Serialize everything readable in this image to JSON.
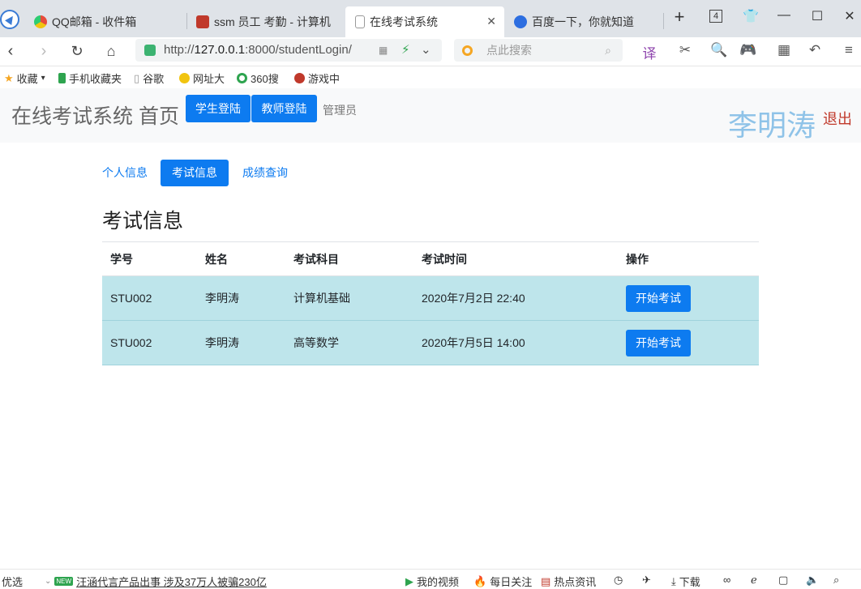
{
  "browser": {
    "tabs": [
      {
        "title": "QQ邮箱 - 收件箱",
        "active": false
      },
      {
        "title": "ssm 员工 考勤 - 计算机",
        "active": false
      },
      {
        "title": "在线考试系统",
        "active": true
      },
      {
        "title": "百度一下，你就知道",
        "active": false
      }
    ],
    "tab_count": "4",
    "url_prefix": "http://",
    "url_host": "127.0.0.1",
    "url_rest": ":8000/studentLogin/",
    "search_placeholder": "点此搜索",
    "bookmarks": [
      "收藏",
      "手机收藏夹",
      "谷歌",
      "网址大",
      "360搜",
      "游戏中"
    ]
  },
  "navbar": {
    "brand": "在线考试系统 首页",
    "student_login": "学生登陆",
    "teacher_login": "教师登陆",
    "admin": "管理员",
    "username": "李明涛",
    "logout": "退出"
  },
  "pills": {
    "profile": "个人信息",
    "exam_info": "考试信息",
    "scores": "成绩查询"
  },
  "main": {
    "heading": "考试信息",
    "columns": [
      "学号",
      "姓名",
      "考试科目",
      "考试时间",
      "操作"
    ],
    "rows": [
      {
        "id": "STU002",
        "name": "李明涛",
        "subject": "计算机基础",
        "time": "2020年7月2日 22:40",
        "action": "开始考试"
      },
      {
        "id": "STU002",
        "name": "李明涛",
        "subject": "高等数学",
        "time": "2020年7月5日 14:00",
        "action": "开始考试"
      }
    ]
  },
  "statusbar": {
    "left": "优选",
    "news_badge": "NEW",
    "news": "汪涵代言产品出事 涉及37万人被骗230亿",
    "video": "我的视频",
    "follow": "每日关注",
    "hot": "热点资讯",
    "download": "下载"
  }
}
